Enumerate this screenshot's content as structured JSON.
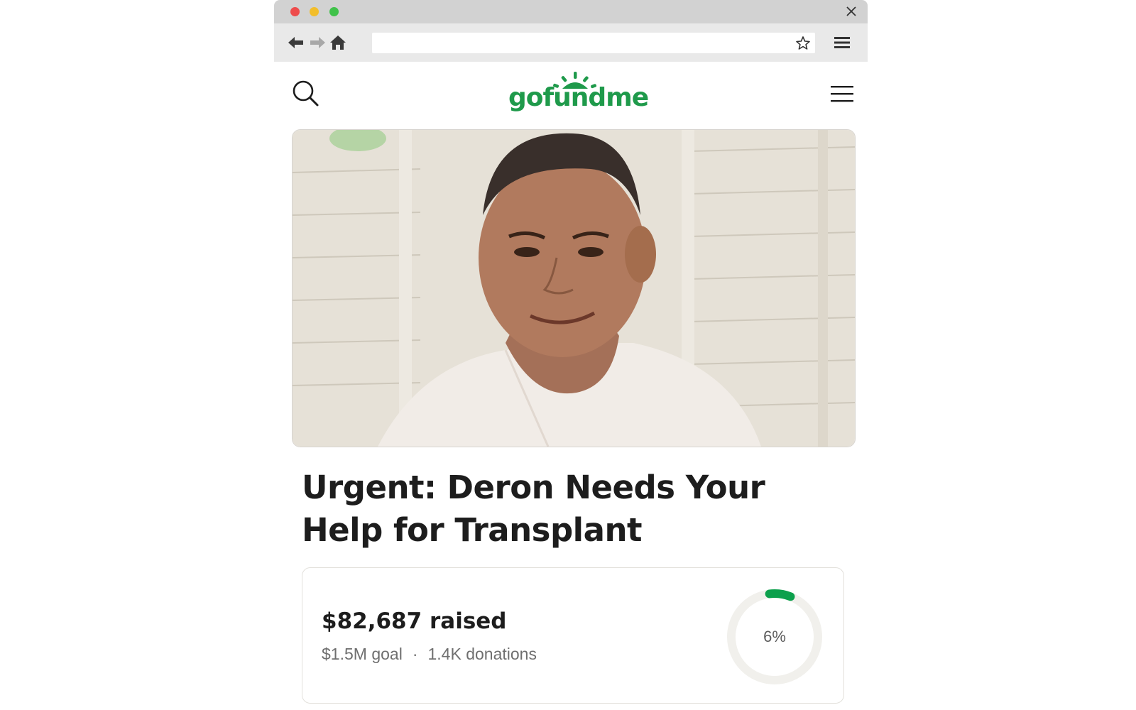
{
  "browser": {
    "url": "",
    "window_controls": [
      "close",
      "minimize",
      "maximize"
    ],
    "icons": [
      "back-arrow-icon",
      "forward-arrow-icon",
      "home-icon",
      "bookmark-star-icon",
      "menu-icon",
      "close-icon"
    ]
  },
  "site": {
    "logo_text": "gofundme",
    "brand_color": "#1f9a4b",
    "icons": [
      "search-icon",
      "hamburger-menu-icon"
    ]
  },
  "campaign": {
    "title": "Urgent: Deron Needs Your Help for Transplant",
    "raised_amount": "$82,687",
    "raised_suffix": "raised",
    "goal": "$1.5M goal",
    "separator": "·",
    "donations": "1.4K donations",
    "progress_label": "6%",
    "progress_value": 0.06,
    "progress_color": "#0ca04c",
    "track_color": "#f1f0ec"
  }
}
